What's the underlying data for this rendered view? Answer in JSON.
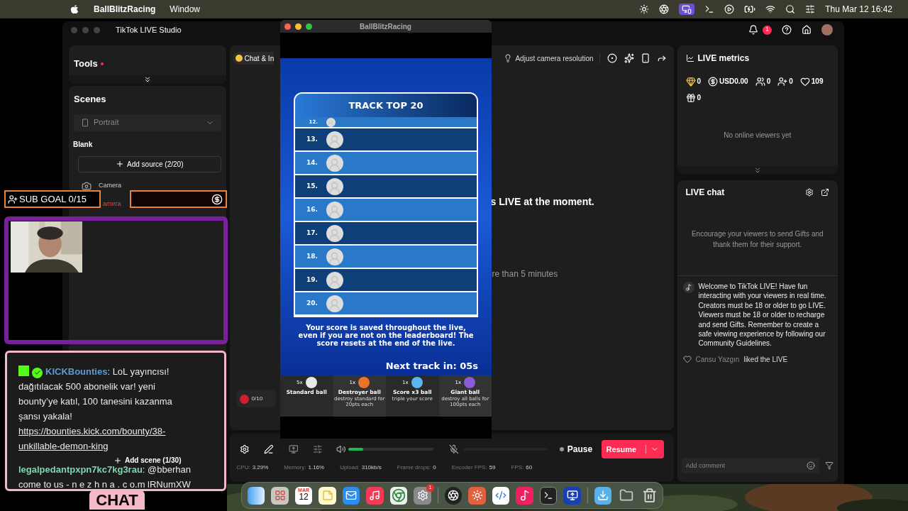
{
  "menubar": {
    "app": "BallBlitzRacing",
    "menus": [
      "Window"
    ],
    "date": "Thu Mar 12",
    "time": "16:42"
  },
  "studio": {
    "title": "TikTok LIVE Studio",
    "notification_count": "1",
    "tools": {
      "title": "Tools"
    },
    "scenes": {
      "title": "Scenes",
      "layout": "Portrait",
      "scene": "Blank",
      "add_source": "Add source (2/20)",
      "sources": [
        {
          "name": "Camera",
          "kind": "ok"
        },
        {
          "name": "amera",
          "kind": "error"
        }
      ],
      "add_scene": "Add scene (1/30)"
    },
    "preview": {
      "chip": "Chat & In",
      "hint": "Adjust camera resolution",
      "message": "s LIVE at the moment.",
      "note": "re than 5 minutes",
      "gift_goal": "0/10"
    },
    "controls": {
      "volume": {
        "level": 0.17
      },
      "mic": {
        "muted": true
      },
      "pause": "Pause",
      "resume": "Resume"
    },
    "stats": [
      {
        "label": "CPU:",
        "value": "3.29%"
      },
      {
        "label": "Memory:",
        "value": "1.16%"
      },
      {
        "label": "Upload:",
        "value": "310kb/s"
      },
      {
        "label": "Frame drops:",
        "value": "0"
      },
      {
        "label": "Encoder FPS:",
        "value": "59"
      },
      {
        "label": "FPS:",
        "value": "60"
      }
    ],
    "metrics": {
      "title": "LIVE metrics",
      "items": [
        {
          "kind": "diamonds",
          "value": "0"
        },
        {
          "kind": "revenue",
          "value": "USD0.00"
        },
        {
          "kind": "viewers",
          "value": "0"
        },
        {
          "kind": "followers",
          "value": "0"
        },
        {
          "kind": "likes",
          "value": "109"
        },
        {
          "kind": "gifts",
          "value": "0"
        }
      ],
      "empty": "No online viewers yet"
    },
    "chat": {
      "title": "LIVE chat",
      "prompt": "Encourage your viewers to send Gifts and thank them for their support.",
      "welcome": "Welcome to TikTok LIVE! Have fun interacting with your viewers in real time. Creators must be 18 or older to go LIVE. Viewers must be 18 or older to recharge and send Gifts. Remember to create a safe viewing experience by following our Community Guidelines.",
      "events": [
        {
          "user": "Cansu Yazgın",
          "action": "liked the LIVE"
        }
      ],
      "placeholder": "Add comment"
    }
  },
  "game": {
    "title": "BallBlitzRacing",
    "board_title": "TRACK TOP 20",
    "rows": [
      "12.",
      "13.",
      "14.",
      "15.",
      "16.",
      "17.",
      "18.",
      "19.",
      "20."
    ],
    "notice": "Your score is saved throughout the live, even if you are not on the leaderboard! The score resets at the end of the live.",
    "countdown": "Next track in: 05s",
    "balls": [
      {
        "count": "5x",
        "name": "Standard ball",
        "color": "#e8e8e8"
      },
      {
        "count": "1x",
        "name": "Destroyer ball",
        "sub": "destroy standard for 20pts each",
        "color": "#e8742c"
      },
      {
        "count": "1x",
        "name": "Score x3 ball",
        "sub": "triple your score",
        "color": "#5ab8f0"
      },
      {
        "count": "1x",
        "name": "Giant ball",
        "sub": "destroy all balls for 100pts each",
        "color": "#8a5ad8"
      }
    ]
  },
  "overlays": {
    "sub_goal": "SUB GOAL 0/15",
    "chat_label": "CHAT",
    "separator": ":",
    "messages": [
      {
        "user": "KICKBounties",
        "color": "#5b9bd5",
        "verified": true,
        "text": "LoL yayıncısı! dağıtılacak 500 abonelik var! yeni bounty’ye katıl, 100 tanesini kazanma şansı yakala!",
        "link": "https://bounties.kick.com/bounty/38-unkillable-demon-king"
      },
      {
        "user": "legalpedantpxpn7kc7kg3rau",
        "color": "#7fd6b0",
        "verified": false,
        "text": "@bberhan come to us - n e z h n a . c o.m lRNumXW"
      }
    ]
  },
  "dock": {
    "calendar_month": "MAR",
    "calendar_day": "12",
    "settings_badge": "1"
  }
}
